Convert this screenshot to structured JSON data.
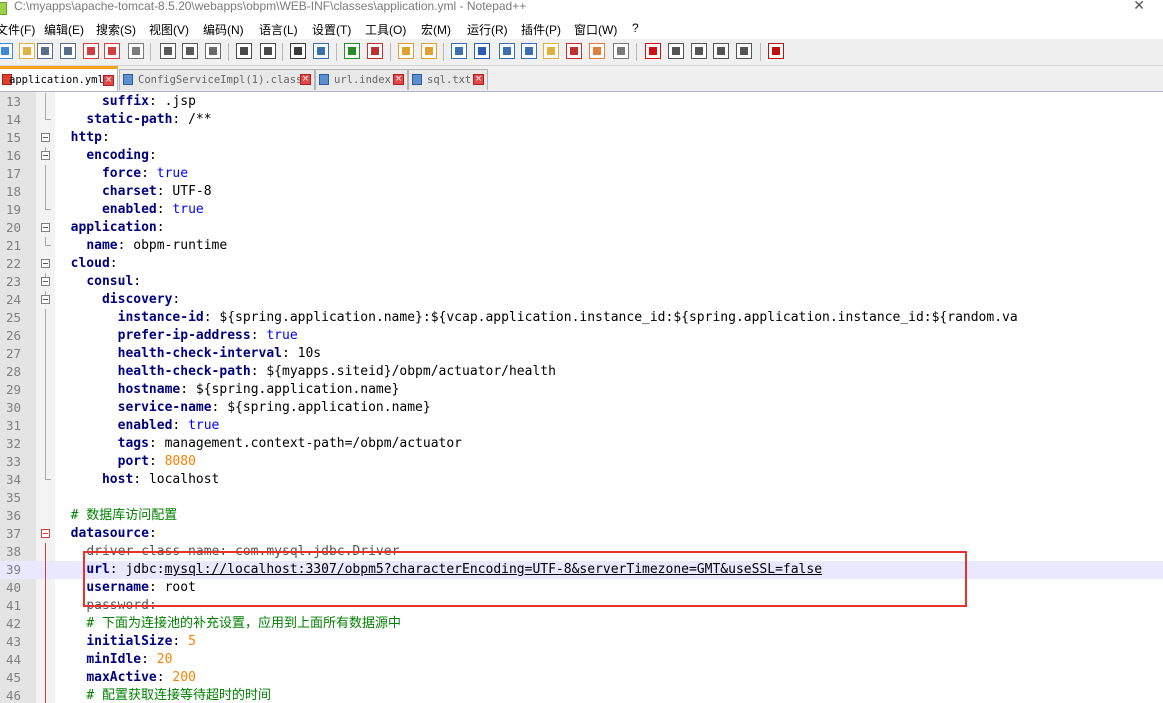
{
  "window": {
    "title": "C:\\myapps\\apache-tomcat-8.5.20\\webapps\\obpm\\WEB-INF\\classes\\application.yml - Notepad++",
    "close_glyph": "✕"
  },
  "menu": [
    "文件(F)",
    "编辑(E)",
    "搜索(S)",
    "视图(V)",
    "编码(N)",
    "语言(L)",
    "设置(T)",
    "工具(O)",
    "宏(M)",
    "运行(R)",
    "插件(P)",
    "窗口(W)",
    "?"
  ],
  "tabs": [
    {
      "label": "application.yml",
      "active": true
    },
    {
      "label": "ConfigServiceImpl(1).class",
      "active": false
    },
    {
      "label": "url.index",
      "active": false
    },
    {
      "label": "sql.txt",
      "active": false
    }
  ],
  "toolbar_icons": [
    "new-file-icon",
    "open-file-icon",
    "save-icon",
    "save-all-icon",
    "close-icon",
    "close-all-icon",
    "print-icon",
    "cut-icon",
    "copy-icon",
    "paste-icon",
    "undo-icon",
    "redo-icon",
    "find-icon",
    "replace-icon",
    "zoom-in-icon",
    "zoom-out-icon",
    "sync-vertical-icon",
    "sync-horizontal-icon",
    "word-wrap-icon",
    "show-all-chars-icon",
    "indent-guide-icon",
    "user-lang-icon",
    "doc-map-icon",
    "function-list-icon",
    "folder-workspace-icon",
    "monitor-icon",
    "record-macro-icon",
    "stop-record-icon",
    "play-macro-icon",
    "run-macro-multiple-icon",
    "save-macro-icon",
    "spell-check-icon"
  ],
  "editor": {
    "current_line": 39,
    "lines": [
      {
        "n": "13",
        "indent": "      ",
        "key": "suffix",
        "sep": ": ",
        "val": ".jsp",
        "vt": "v"
      },
      {
        "n": "14",
        "indent": "    ",
        "key": "static-path",
        "sep": ": ",
        "val": "/**",
        "vt": "v"
      },
      {
        "n": "15",
        "indent": "  ",
        "key": "http",
        "sep": ":",
        "val": "",
        "vt": "v"
      },
      {
        "n": "16",
        "indent": "    ",
        "key": "encoding",
        "sep": ":",
        "val": "",
        "vt": "v"
      },
      {
        "n": "17",
        "indent": "      ",
        "key": "force",
        "sep": ": ",
        "val": "true",
        "vt": "bool"
      },
      {
        "n": "18",
        "indent": "      ",
        "key": "charset",
        "sep": ": ",
        "val": "UTF-8",
        "vt": "v"
      },
      {
        "n": "19",
        "indent": "      ",
        "key": "enabled",
        "sep": ": ",
        "val": "true",
        "vt": "bool"
      },
      {
        "n": "20",
        "indent": "  ",
        "key": "application",
        "sep": ":",
        "val": "",
        "vt": "v"
      },
      {
        "n": "21",
        "indent": "    ",
        "key": "name",
        "sep": ": ",
        "val": "obpm-runtime",
        "vt": "v"
      },
      {
        "n": "22",
        "indent": "  ",
        "key": "cloud",
        "sep": ":",
        "val": "",
        "vt": "v"
      },
      {
        "n": "23",
        "indent": "    ",
        "key": "consul",
        "sep": ":",
        "val": "",
        "vt": "v"
      },
      {
        "n": "24",
        "indent": "      ",
        "key": "discovery",
        "sep": ":",
        "val": "",
        "vt": "v"
      },
      {
        "n": "25",
        "indent": "        ",
        "key": "instance-id",
        "sep": ": ",
        "val": "${spring.application.name}:${vcap.application.instance_id:${spring.application.instance_id:${random.va",
        "vt": "v"
      },
      {
        "n": "26",
        "indent": "        ",
        "key": "prefer-ip-address",
        "sep": ": ",
        "val": "true",
        "vt": "bool"
      },
      {
        "n": "27",
        "indent": "        ",
        "key": "health-check-interval",
        "sep": ": ",
        "val": "10s",
        "vt": "v"
      },
      {
        "n": "28",
        "indent": "        ",
        "key": "health-check-path",
        "sep": ": ",
        "val": "${myapps.siteid}/obpm/actuator/health",
        "vt": "v"
      },
      {
        "n": "29",
        "indent": "        ",
        "key": "hostname",
        "sep": ": ",
        "val": "${spring.application.name}",
        "vt": "v"
      },
      {
        "n": "30",
        "indent": "        ",
        "key": "service-name",
        "sep": ": ",
        "val": "${spring.application.name}",
        "vt": "v"
      },
      {
        "n": "31",
        "indent": "        ",
        "key": "enabled",
        "sep": ": ",
        "val": "true",
        "vt": "bool"
      },
      {
        "n": "32",
        "indent": "        ",
        "key": "tags",
        "sep": ": ",
        "val": "management.context-path=/obpm/actuator",
        "vt": "v"
      },
      {
        "n": "33",
        "indent": "        ",
        "key": "port",
        "sep": ": ",
        "val": "8080",
        "vt": "num"
      },
      {
        "n": "34",
        "indent": "      ",
        "key": "host",
        "sep": ": ",
        "val": "localhost",
        "vt": "v"
      },
      {
        "n": "35",
        "indent": "",
        "key": "",
        "sep": "",
        "val": "",
        "vt": "v"
      },
      {
        "n": "36",
        "indent": "  ",
        "key": "",
        "sep": "",
        "val": "# 数据库访问配置",
        "vt": "cmt"
      },
      {
        "n": "37",
        "indent": "  ",
        "key": "datasource",
        "sep": ":",
        "val": "",
        "vt": "v"
      },
      {
        "n": "38",
        "indent": "    ",
        "key": "driver-class-name",
        "sep": ": ",
        "val": "com.mysql.jdbc.Driver",
        "vt": "strike"
      },
      {
        "n": "39",
        "indent": "    ",
        "key": "url",
        "sep": ": ",
        "val": "jdbc:mysql://localhost:3307/obpm5?characterEncoding=UTF-8&serverTimezone=GMT&useSSL=false",
        "vt": "v"
      },
      {
        "n": "40",
        "indent": "    ",
        "key": "username",
        "sep": ": ",
        "val": "root",
        "vt": "v"
      },
      {
        "n": "41",
        "indent": "    ",
        "key": "password",
        "sep": ":",
        "val": "",
        "vt": "strike"
      },
      {
        "n": "42",
        "indent": "    ",
        "key": "",
        "sep": "",
        "val": "# 下面为连接池的补充设置，应用到上面所有数据源中",
        "vt": "cmt"
      },
      {
        "n": "43",
        "indent": "    ",
        "key": "initialSize",
        "sep": ": ",
        "val": "5",
        "vt": "num"
      },
      {
        "n": "44",
        "indent": "    ",
        "key": "minIdle",
        "sep": ": ",
        "val": "20",
        "vt": "num"
      },
      {
        "n": "45",
        "indent": "    ",
        "key": "maxActive",
        "sep": ": ",
        "val": "200",
        "vt": "num"
      },
      {
        "n": "46",
        "indent": "    ",
        "key": "",
        "sep": "",
        "val": "# 配置获取连接等待超时的时间",
        "vt": "cmt"
      }
    ]
  },
  "colors": {
    "keyword": "#000080",
    "boolean": "#0000ff",
    "number": "#ff8000",
    "comment": "#008000",
    "active_tab_accent": "#f7a21b",
    "annotation_box": "#e8322e",
    "current_line_bg": "#e8e8ff"
  }
}
